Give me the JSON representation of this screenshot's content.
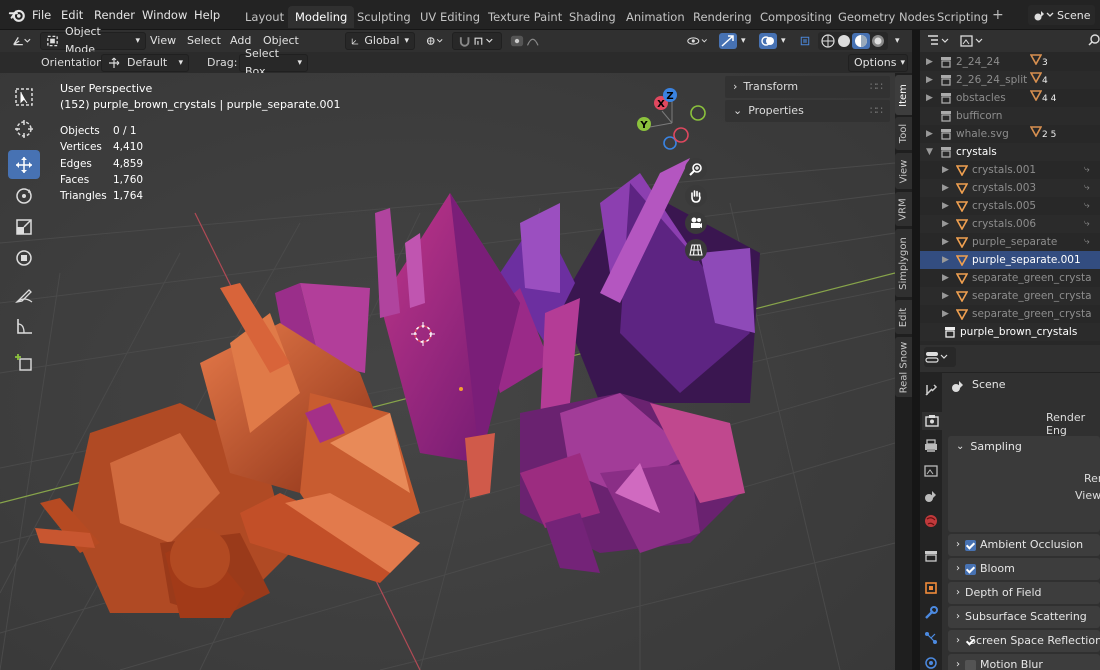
{
  "menu": [
    "File",
    "Edit",
    "Render",
    "Window",
    "Help"
  ],
  "workspaces": [
    "Layout",
    "Modeling",
    "Sculpting",
    "UV Editing",
    "Texture Paint",
    "Shading",
    "Animation",
    "Rendering",
    "Compositing",
    "Geometry Nodes",
    "Scripting"
  ],
  "active_workspace": "Modeling",
  "add_workspace": "+",
  "scene_name": "Scene",
  "header": {
    "mode": "Object Mode",
    "view": "View",
    "select": "Select",
    "add": "Add",
    "object": "Object",
    "orientation_global": "Global"
  },
  "header2": {
    "orientation_label": "Orientation:",
    "orientation_value": "Default",
    "drag_label": "Drag:",
    "drag_value": "Select Box",
    "options": "Options"
  },
  "viewport": {
    "perspective": "User Perspective",
    "object_info": "(152) purple_brown_crystals | purple_separate.001",
    "stats": [
      {
        "label": "Objects",
        "value": "0 / 1"
      },
      {
        "label": "Vertices",
        "value": "4,410"
      },
      {
        "label": "Edges",
        "value": "4,859"
      },
      {
        "label": "Faces",
        "value": "1,760"
      },
      {
        "label": "Triangles",
        "value": "1,764"
      }
    ],
    "npanel": {
      "transform": "Transform",
      "properties": "Properties"
    },
    "gizmo": {
      "x": "X",
      "y": "Y",
      "z": "Z"
    }
  },
  "side_tabs": [
    "Item",
    "Tool",
    "View",
    "VRM",
    "Simplygon",
    "Edit",
    "Real Snow"
  ],
  "outliner": [
    {
      "name": "2_24_24",
      "badge": "3",
      "indent": 1,
      "expand": true
    },
    {
      "name": "2_26_24_split",
      "badge": "4",
      "indent": 1,
      "expand": true
    },
    {
      "name": "obstacles",
      "badge": "4 4",
      "indent": 1,
      "expand": true
    },
    {
      "name": "bufficorn",
      "badge": "",
      "indent": 1,
      "expand": false
    },
    {
      "name": "whale.svg",
      "badge": "2 5",
      "indent": 1,
      "expand": true
    },
    {
      "name": "crystals",
      "badge": "",
      "indent": 1,
      "expand": true,
      "open": true
    },
    {
      "name": "crystals.001",
      "badge": "",
      "indent": 2,
      "expand": true
    },
    {
      "name": "crystals.003",
      "badge": "",
      "indent": 2,
      "expand": true
    },
    {
      "name": "crystals.005",
      "badge": "",
      "indent": 2,
      "expand": true
    },
    {
      "name": "crystals.006",
      "badge": "",
      "indent": 2,
      "expand": true
    },
    {
      "name": "purple_separate",
      "badge": "",
      "indent": 2,
      "expand": true
    },
    {
      "name": "purple_separate.001",
      "badge": "",
      "indent": 2,
      "expand": true,
      "active": true
    },
    {
      "name": "separate_green_crysta",
      "badge": "",
      "indent": 2,
      "expand": true
    },
    {
      "name": "separate_green_crysta",
      "badge": "",
      "indent": 2,
      "expand": true
    },
    {
      "name": "separate_green_crysta",
      "badge": "",
      "indent": 2,
      "expand": true
    },
    {
      "name": "purple_brown_crystals",
      "badge": "",
      "indent": 0,
      "expand": false,
      "white": true
    }
  ],
  "properties": {
    "scene": "Scene",
    "render_engine": "Render Eng",
    "sampling": "Sampling",
    "sampling_render": "Ren",
    "sampling_viewport": "View",
    "sections": [
      {
        "label": "Ambient Occlusion",
        "check": true
      },
      {
        "label": "Bloom",
        "check": true
      },
      {
        "label": "Depth of Field",
        "check": null
      },
      {
        "label": "Subsurface Scattering",
        "check": null
      },
      {
        "label": "Screen Space Reflections",
        "check": true
      },
      {
        "label": "Motion Blur",
        "check": false
      }
    ]
  },
  "colors": {
    "accent": "#4772b3",
    "axis_x": "#e0485f",
    "axis_y": "#8bc23c",
    "axis_z": "#3a83e1",
    "crystal_orange": "#c2552c",
    "crystal_purple": "#7a2a8e"
  }
}
